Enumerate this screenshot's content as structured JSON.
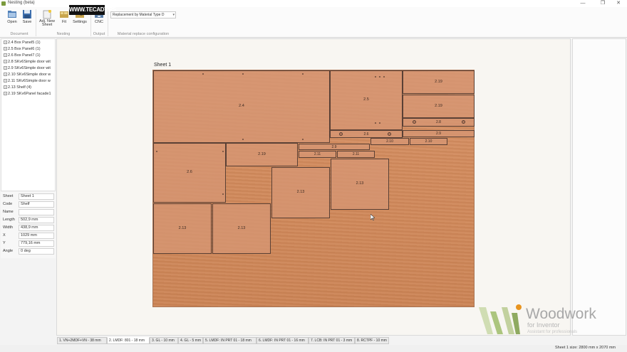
{
  "window": {
    "title": "Nesting (beta)",
    "controls": [
      "—",
      "❒",
      "✕"
    ]
  },
  "watermark": "WWW.TECADTIPS",
  "ribbon": {
    "buttons": {
      "open": "Open",
      "save": "Save",
      "adj_new_sheet": "Adj. New Sheet",
      "fit": "Fit",
      "settings": "Settings",
      "cnc": "CNC"
    },
    "groups": {
      "document": "Document",
      "nesting": "Nesting",
      "output": "Output",
      "material": "Material replace configuration"
    },
    "material_combo": "Replacement by Material Type D"
  },
  "tree": {
    "items": [
      "2.4 Box Panel5 (1)",
      "2.5 Box Panel6 (1)",
      "2.6 Box Panel7 (1)",
      "2.8 SKv6Simple door wit",
      "2.9 SKv6Simple door wit",
      "2.10 SKv6Simple door w",
      "2.11 SKv6Simple door w",
      "2.13 Shelf (4)",
      "2.19 SKv6Panel facade1"
    ]
  },
  "properties": {
    "labels": [
      "Sheet",
      "Code",
      "Name",
      "Length",
      "Width",
      "X",
      "Y",
      "Angle"
    ],
    "values": [
      "Sheet 1",
      "Shelf",
      "",
      "502,9 mm",
      "438,9 mm",
      "1029 mm",
      "779,16 mm",
      "0 deg"
    ]
  },
  "sheet": {
    "title": "Sheet 1",
    "parts": [
      "2.4",
      "2.5",
      "2.19",
      "2.19",
      "2.8",
      "2.6",
      "2.9",
      "2.10",
      "2.10",
      "2.9",
      "2.11",
      "2.11",
      "2.19",
      "2.6",
      "2.13",
      "2.13",
      "2.13",
      "2.13"
    ]
  },
  "logo": {
    "brand": "Woodwork",
    "sub": "for Inventor",
    "tagline": "Assistant for professionals"
  },
  "tabs": [
    "1. VN+2MDF+VN - 38 mm",
    "2. LMDF: 801 - 18 mm",
    "3. GL - 10 mm",
    "4. GL - 5 mm",
    "5. LMDF: IN PRT 01 - 18 mm",
    "6. LMDF: IN PRT 01 - 16 mm",
    "7. LCB: IN PRT 01 - 3 mm",
    "8. RCTPF - 10 mm"
  ],
  "status": "Sheet 1 size: 2800 mm x 2070 mm",
  "colors": {
    "accent": "#7b9a3c",
    "sheet_wood": "#d28a5c",
    "part_fill": "#d69673",
    "part_border": "#5a4035"
  }
}
